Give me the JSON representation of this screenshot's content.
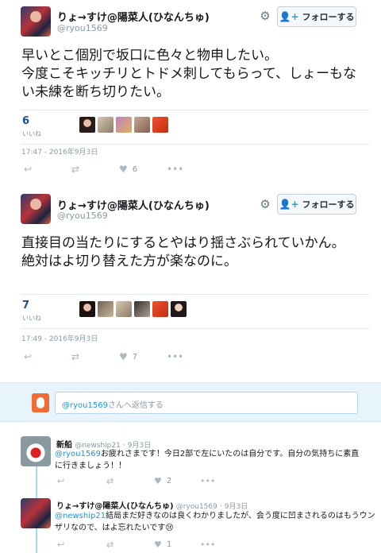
{
  "tweets": [
    {
      "name": "りょ→すけ@陽菜人(ひなんちゅ)",
      "handle": "@ryou1569",
      "follow_label": "フォローする",
      "text_lines": [
        "早いとこ個別で坂口に色々と物申したい。",
        "今度こそキッチリとトドメ刺してもらって、しょーもな",
        "い未練を断ち切りたい。"
      ],
      "likes_count": "6",
      "likes_label": "いいね",
      "timestamp": "17:47 - 2016年9月3日",
      "like_action_count": "6"
    },
    {
      "name": "りょ→すけ@陽菜人(ひなんちゅ)",
      "handle": "@ryou1569",
      "follow_label": "フォローする",
      "text_lines": [
        "直接目の当たりにするとやはり揺さぶられていかん。",
        "絶対はよ切り替えた方が楽なのに。"
      ],
      "likes_count": "7",
      "likes_label": "いいね",
      "timestamp": "17:49 - 2016年9月3日",
      "like_action_count": "7"
    }
  ],
  "reply_box": {
    "mention": "@ryou1569",
    "suffix": "さんへ返信する"
  },
  "replies": [
    {
      "name": "新船",
      "handle": "@newship21",
      "date": "· 9月3日",
      "mention": "@ryou1569",
      "line1": "お疲れさまです！今日2部で左にいたのは自分です。自分の気持ちに素直",
      "line2": "に行きましょう！！",
      "like_count": "2"
    },
    {
      "name": "りょ→すけ@陽菜人(ひなんちゅ)",
      "handle": "@ryou1569",
      "date": "· 9月3日",
      "mention": "@newship21",
      "line1": "結局まだ好きなのは良くわかりましたが、会う度に凹まされるのはもうウン",
      "line2": "ザリなので、はよ忘れたいです😢",
      "like_count": "1"
    }
  ],
  "icons": {
    "gear": "gear-icon",
    "follow": "add-user-icon",
    "reply": "reply-icon",
    "retweet": "retweet-icon",
    "like": "heart-icon",
    "more": "more-icon"
  },
  "colors": {
    "accent": "#1da1f2",
    "likes_count": "#1b4f8a",
    "reply_area_bg": "#e8f4fb"
  }
}
